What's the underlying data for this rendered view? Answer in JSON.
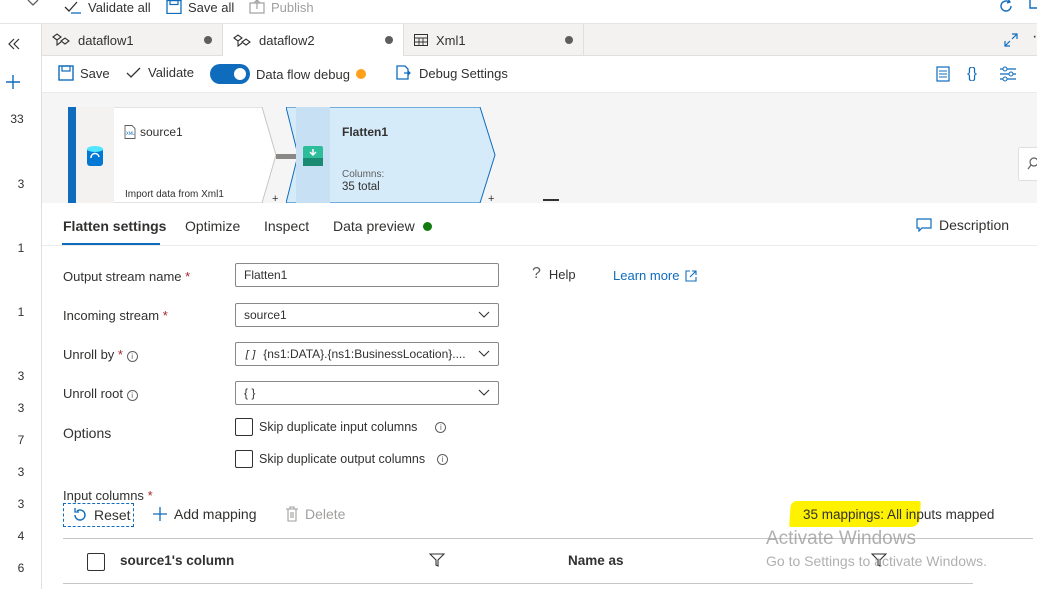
{
  "topbar": {
    "validate_all": "Validate all",
    "save_all": "Save all",
    "publish": "Publish"
  },
  "rail": {
    "numbers": [
      "33",
      "3",
      "1",
      "1",
      "3",
      "3",
      "7",
      "3",
      "3",
      "4",
      "6"
    ]
  },
  "tabs": [
    {
      "label": "dataflow1"
    },
    {
      "label": "dataflow2"
    },
    {
      "label": "Xml1"
    }
  ],
  "toolbar": {
    "save": "Save",
    "validate": "Validate",
    "debug": "Data flow debug",
    "debug_settings": "Debug Settings"
  },
  "canvas": {
    "source_name": "source1",
    "source_sub": "Import data from Xml1",
    "flatten_name": "Flatten1",
    "flatten_columns_label": "Columns:",
    "flatten_columns_value": "35 total"
  },
  "panel": {
    "tabs": [
      "Flatten settings",
      "Optimize",
      "Inspect",
      "Data preview"
    ],
    "description": "Description",
    "help": "Help",
    "learn_more": "Learn more",
    "output_stream_label": "Output stream name",
    "output_stream_value": "Flatten1",
    "incoming_stream_label": "Incoming stream",
    "incoming_stream_value": "source1",
    "unroll_by_label": "Unroll by",
    "unroll_by_value": "{ns1:DATA}.{ns1:BusinessLocation}....",
    "unroll_root_label": "Unroll root",
    "unroll_root_value": "{ }",
    "options_label": "Options",
    "skip_input": "Skip duplicate input columns",
    "skip_output": "Skip duplicate output columns",
    "input_columns_label": "Input columns",
    "reset": "Reset",
    "add_mapping": "Add mapping",
    "delete": "Delete",
    "mappings_status": "35 mappings: All inputs mapped",
    "col_source": "source1's column",
    "col_name_as": "Name as"
  },
  "watermark": {
    "line1": "Activate Windows",
    "line2": "Go to Settings to activate Windows."
  },
  "colors": {
    "accent": "#0f6cbd",
    "debug_dot": "#ff9f1a",
    "preview_dot": "#107c10",
    "highlight": "#fff200",
    "flatten_node": "#d6ebfa"
  }
}
